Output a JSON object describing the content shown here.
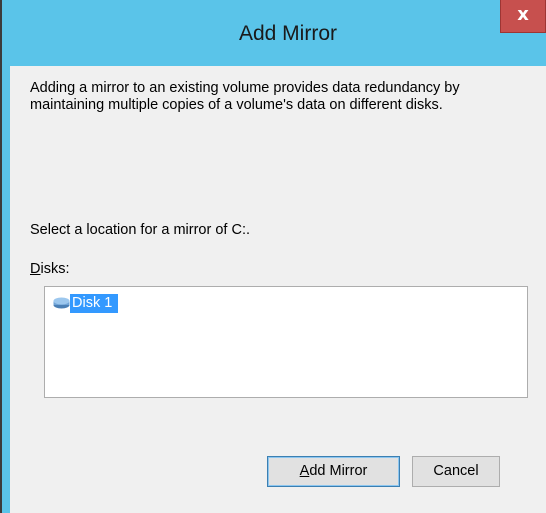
{
  "window": {
    "title": "Add Mirror",
    "close_glyph": "x",
    "accent_color": "#5ac4e9",
    "close_color": "#c7504e"
  },
  "content": {
    "description": "Adding a mirror to an existing volume provides data redundancy by maintaining multiple copies of a volume's data on different disks.",
    "select_prompt": "Select a location for a mirror of C:.",
    "disks_label_access_key": "D",
    "disks_label_rest": "isks:"
  },
  "disks": [
    {
      "label": "Disk 1",
      "icon": "disk-icon",
      "selected": true
    }
  ],
  "buttons": {
    "add_mirror_access_key": "A",
    "add_mirror_rest": "dd Mirror",
    "cancel": "Cancel"
  }
}
